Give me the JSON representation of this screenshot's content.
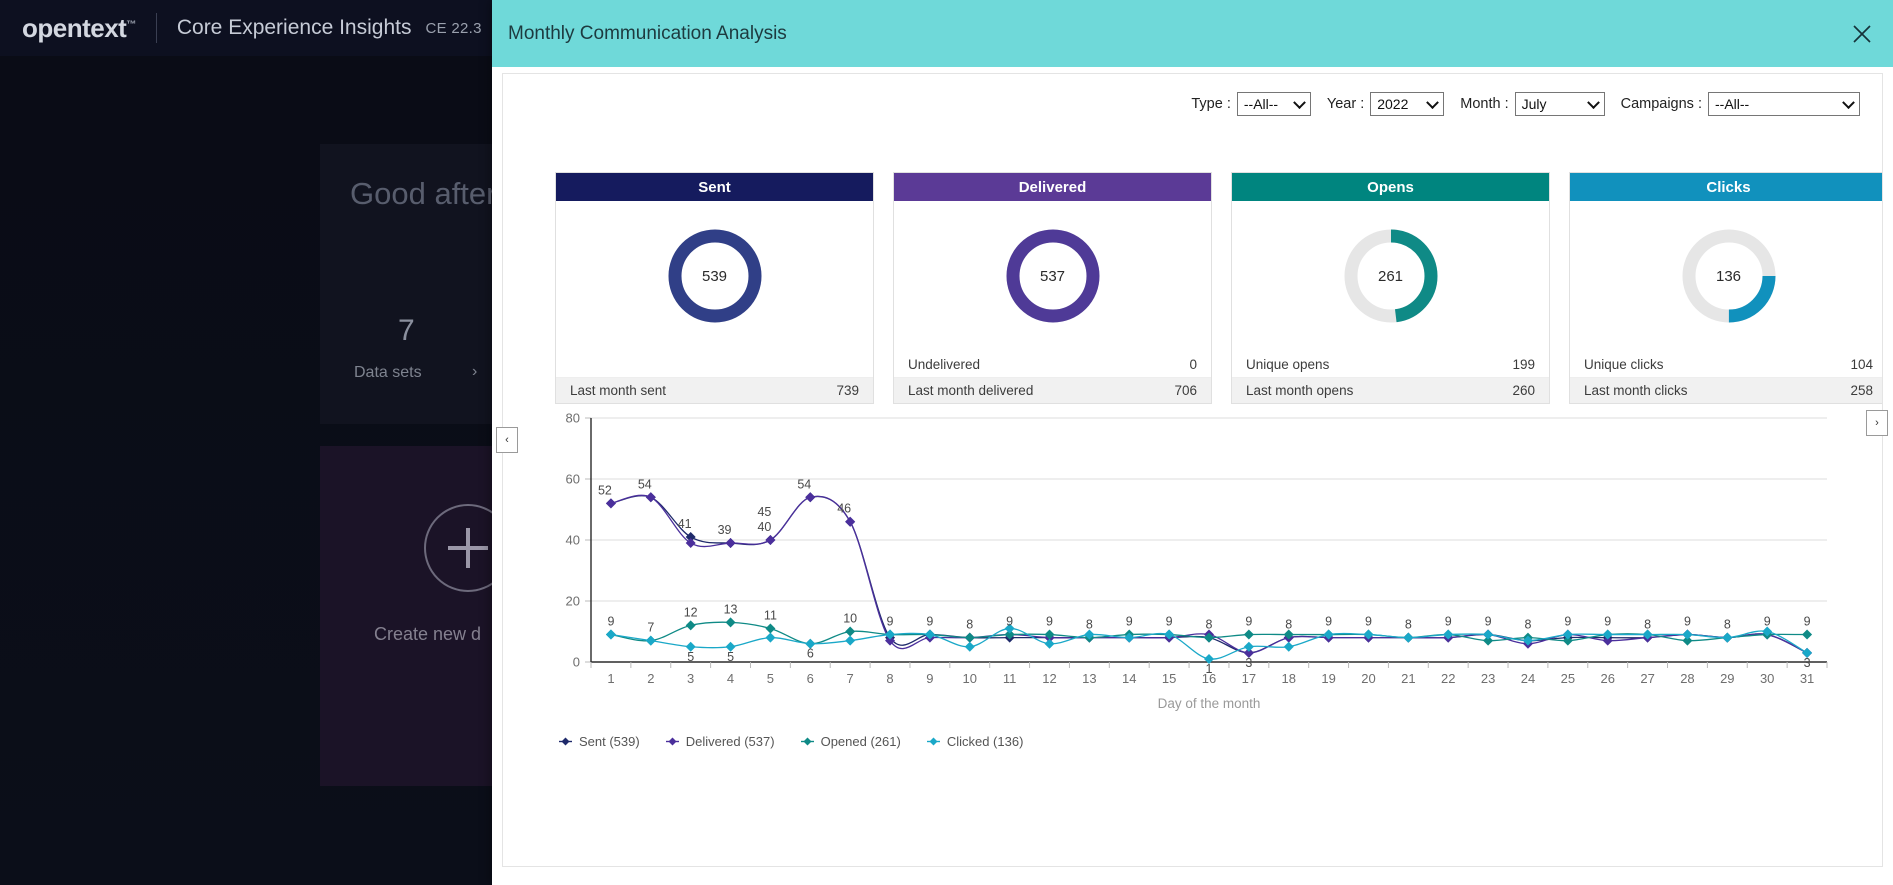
{
  "background": {
    "brand": "opentext",
    "trademark": "™",
    "product": "Core Experience Insights",
    "version": "CE 22.3",
    "greeting": "Good aftern",
    "datasets_count": "7",
    "datasets_label": "Data sets",
    "datasets_arrow": "›",
    "create_label": "Create new d"
  },
  "toggles": {
    "left": "‹",
    "right": "›"
  },
  "modal": {
    "title": "Monthly Communication Analysis",
    "close_icon": "close-icon"
  },
  "filters": [
    {
      "label": "Type :",
      "value": "--All--",
      "name": "type"
    },
    {
      "label": "Year :",
      "value": "2022",
      "name": "year"
    },
    {
      "label": "Month :",
      "value": "July",
      "name": "month"
    },
    {
      "label": "Campaigns :",
      "value": "--All--",
      "name": "campaigns"
    }
  ],
  "kpis": [
    {
      "title": "Sent",
      "header_color": "#151b5e",
      "ring_color": "#303f87",
      "value": "539",
      "percent": 100,
      "sub_label": "",
      "sub_value": "",
      "foot_label": "Last month sent",
      "foot_value": "739"
    },
    {
      "title": "Delivered",
      "header_color": "#5b3a96",
      "ring_color": "#4f3a97",
      "value": "537",
      "percent": 100,
      "sub_label": "Undelivered",
      "sub_value": "0",
      "foot_label": "Last month delivered",
      "foot_value": "706"
    },
    {
      "title": "Opens",
      "header_color": "#00857f",
      "ring_color": "#0f8a86",
      "value": "261",
      "percent": 48,
      "sub_label": "Unique opens",
      "sub_value": "199",
      "foot_label": "Last month opens",
      "foot_value": "260"
    },
    {
      "title": "Clicks",
      "header_color": "#1191bd",
      "ring_color": "#1191bd",
      "value": "136",
      "percent": 25,
      "sub_label": "Unique clicks",
      "sub_value": "104",
      "foot_label": "Last month clicks",
      "foot_value": "258"
    }
  ],
  "chart_data": {
    "type": "line",
    "title": "",
    "xlabel": "Day of the month",
    "ylabel": "",
    "ylim": [
      0,
      80
    ],
    "yticks": [
      0,
      20,
      40,
      60,
      80
    ],
    "grid": true,
    "legend_position": "bottom-left",
    "x": [
      1,
      2,
      3,
      4,
      5,
      6,
      7,
      8,
      9,
      10,
      11,
      12,
      13,
      14,
      15,
      16,
      17,
      18,
      19,
      20,
      21,
      22,
      23,
      24,
      25,
      26,
      27,
      28,
      29,
      30,
      31
    ],
    "categories": [
      "1",
      "2",
      "3",
      "4",
      "5",
      "6",
      "7",
      "8",
      "9",
      "10",
      "11",
      "12",
      "13",
      "14",
      "15",
      "16",
      "17",
      "18",
      "19",
      "20",
      "21",
      "22",
      "23",
      "24",
      "25",
      "26",
      "27",
      "28",
      "29",
      "30",
      "31"
    ],
    "series": [
      {
        "name": "Sent (539)",
        "label": "Sent",
        "total": "539",
        "color": "#1f2a6b",
        "values": [
          52,
          54,
          41,
          39,
          40,
          54,
          46,
          8,
          9,
          8,
          8,
          8,
          8,
          8,
          8,
          8,
          3,
          8,
          8,
          8,
          8,
          8,
          9,
          7,
          8,
          8,
          8,
          9,
          8,
          9,
          3
        ]
      },
      {
        "name": "Delivered (537)",
        "label": "Delivered",
        "total": "537",
        "color": "#4b2f9c",
        "values": [
          52,
          54,
          39,
          39,
          40,
          54,
          46,
          7,
          8,
          8,
          9,
          8,
          8,
          8,
          8,
          9,
          3,
          8,
          8,
          8,
          8,
          8,
          9,
          6,
          9,
          7,
          8,
          9,
          8,
          9,
          3
        ]
      },
      {
        "name": "Opened (261)",
        "label": "Opened",
        "total": "261",
        "color": "#0f8a86",
        "values": [
          9,
          7,
          12,
          13,
          11,
          6,
          10,
          9,
          9,
          8,
          9,
          9,
          8,
          9,
          9,
          8,
          9,
          9,
          9,
          9,
          8,
          9,
          7,
          8,
          7,
          9,
          9,
          7,
          8,
          9,
          9
        ]
      },
      {
        "name": "Clicked (136)",
        "label": "Clicked",
        "total": "136",
        "color": "#1aa8c8",
        "values": [
          9,
          7,
          5,
          5,
          8,
          6,
          7,
          9,
          9,
          5,
          11,
          6,
          9,
          8,
          9,
          1,
          5,
          5,
          9,
          9,
          8,
          9,
          9,
          7,
          9,
          9,
          9,
          9,
          8,
          10,
          3
        ]
      }
    ],
    "data_labels": {
      "top_series": [
        {
          "x": 1,
          "text": "52"
        },
        {
          "x": 2,
          "text": "54"
        },
        {
          "x": 3,
          "text": "41"
        },
        {
          "x": 4,
          "text": "39"
        },
        {
          "x": 5,
          "text": "45"
        },
        {
          "x": 5,
          "text": "40"
        },
        {
          "x": 6,
          "text": "54"
        },
        {
          "x": 7,
          "text": "46"
        }
      ],
      "bottom_series": [
        {
          "x": 1,
          "text": "9"
        },
        {
          "x": 2,
          "text": "7"
        },
        {
          "x": 3,
          "text": "12"
        },
        {
          "x": 3,
          "text": "5"
        },
        {
          "x": 4,
          "text": "13"
        },
        {
          "x": 4,
          "text": "5"
        },
        {
          "x": 5,
          "text": "11"
        },
        {
          "x": 6,
          "text": "6"
        },
        {
          "x": 7,
          "text": "10"
        },
        {
          "x": 8,
          "text": "9"
        },
        {
          "x": 9,
          "text": "9"
        },
        {
          "x": 10,
          "text": "8"
        },
        {
          "x": 11,
          "text": "9"
        },
        {
          "x": 12,
          "text": "9"
        },
        {
          "x": 13,
          "text": "8"
        },
        {
          "x": 14,
          "text": "9"
        },
        {
          "x": 15,
          "text": "9"
        },
        {
          "x": 16,
          "text": "8"
        },
        {
          "x": 16,
          "text": "1"
        },
        {
          "x": 17,
          "text": "9"
        },
        {
          "x": 17,
          "text": "3"
        },
        {
          "x": 18,
          "text": "8"
        },
        {
          "x": 19,
          "text": "9"
        },
        {
          "x": 20,
          "text": "9"
        },
        {
          "x": 21,
          "text": "8"
        },
        {
          "x": 22,
          "text": "9"
        },
        {
          "x": 23,
          "text": "9"
        },
        {
          "x": 24,
          "text": "8"
        },
        {
          "x": 25,
          "text": "9"
        },
        {
          "x": 26,
          "text": "9"
        },
        {
          "x": 27,
          "text": "8"
        },
        {
          "x": 28,
          "text": "9"
        },
        {
          "x": 29,
          "text": "8"
        },
        {
          "x": 30,
          "text": "9"
        },
        {
          "x": 31,
          "text": "9"
        },
        {
          "x": 31,
          "text": "3"
        }
      ]
    }
  }
}
